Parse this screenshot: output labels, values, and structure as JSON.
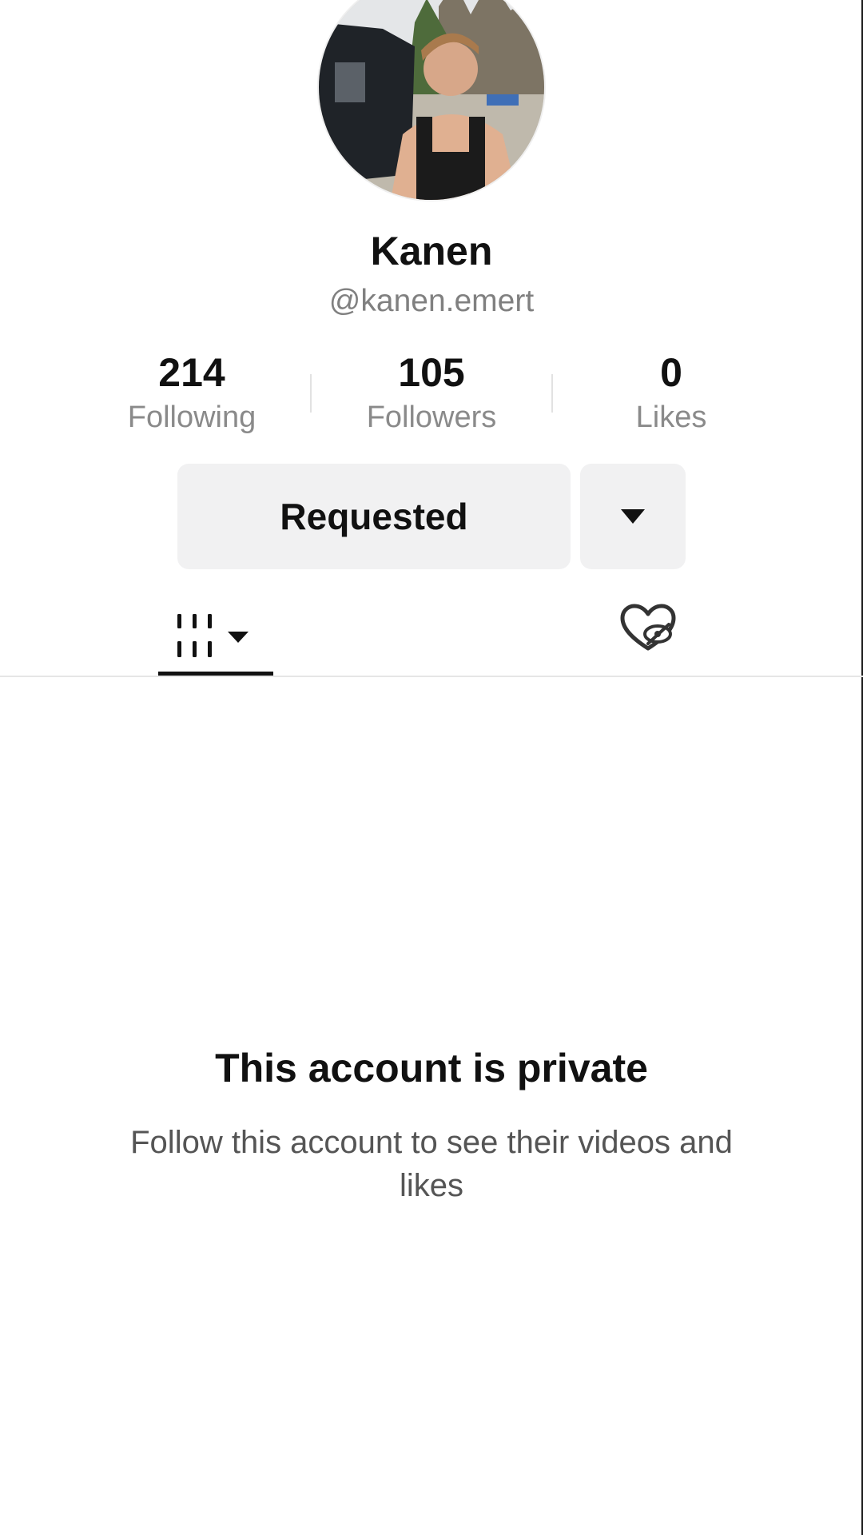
{
  "profile": {
    "display_name": "Kanen",
    "handle": "@kanen.emert",
    "avatar_description": "profile-photo"
  },
  "stats": [
    {
      "value": "214",
      "label": "Following"
    },
    {
      "value": "105",
      "label": "Followers"
    },
    {
      "value": "0",
      "label": "Likes"
    }
  ],
  "actions": {
    "requested_label": "Requested",
    "more_icon": "caret-down-icon"
  },
  "tabs": {
    "videos_icon": "video-grid-icon",
    "videos_dropdown_icon": "caret-down-icon",
    "liked_icon": "liked-hidden-icon",
    "active": "videos"
  },
  "private": {
    "title": "This account is private",
    "description": "Follow this account to see their videos and likes"
  },
  "colors": {
    "background": "#ffffff",
    "button_bg": "#f1f1f2",
    "primary_text": "#111111",
    "secondary_text": "#8a8a8a"
  }
}
